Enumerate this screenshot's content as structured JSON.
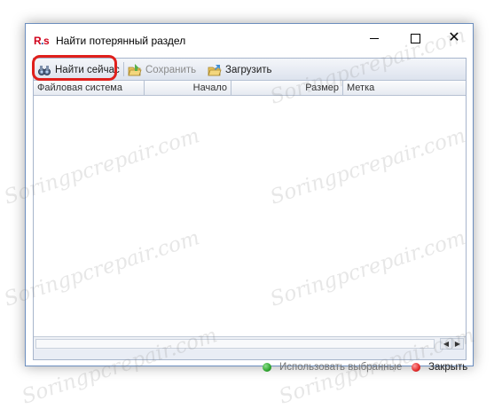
{
  "window": {
    "logo": {
      "r": "R",
      "dot": ".",
      "s": "s"
    },
    "title": "Найти потерянный раздел",
    "minimize_icon": "minimize-icon",
    "maximize_icon": "maximize-icon",
    "close_icon": "close-icon",
    "close_glyph": "✕"
  },
  "toolbar": {
    "find_label": "Найти сейчас",
    "save_label": "Сохранить",
    "load_label": "Загрузить"
  },
  "table": {
    "columns": [
      "Файловая система",
      "Начало",
      "Размер",
      "Метка"
    ],
    "rows": []
  },
  "scrollbar": {
    "left_arrow": "◀",
    "right_arrow": "▶"
  },
  "footer": {
    "use_selected_label": "Использовать выбранные",
    "close_label": "Закрыть"
  },
  "watermark": "Soringpcrepair.com",
  "colors": {
    "highlight": "#e0201c",
    "use_dot": "#2fa52f",
    "close_dot": "#e22a2a"
  }
}
